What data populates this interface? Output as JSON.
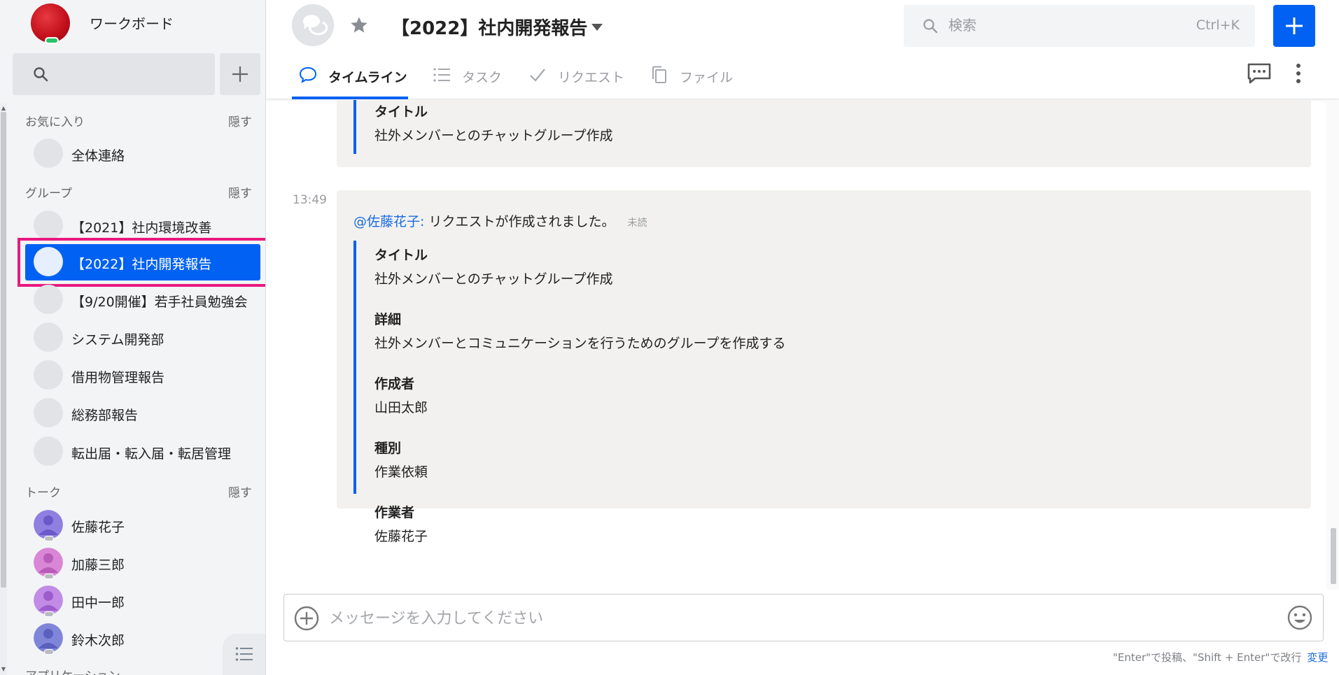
{
  "workspace": {
    "name": "ワークボード"
  },
  "sidebar": {
    "sections": {
      "favorites": {
        "title": "お気に入り",
        "hide_label": "隠す",
        "items": [
          {
            "label": "全体連絡"
          }
        ]
      },
      "groups": {
        "title": "グループ",
        "hide_label": "隠す",
        "items": [
          {
            "label": "【2021】社内環境改善"
          },
          {
            "label": "【2022】社内開発報告",
            "active": true
          },
          {
            "label": "【9/20開催】若手社員勉強会"
          },
          {
            "label": "システム開発部"
          },
          {
            "label": "借用物管理報告"
          },
          {
            "label": "総務部報告"
          },
          {
            "label": "転出届・転入届・転居管理"
          }
        ]
      },
      "talks": {
        "title": "トーク",
        "hide_label": "隠す",
        "items": [
          {
            "label": "佐藤花子",
            "avatar_color": "#8f7fe0"
          },
          {
            "label": "加藤三郎",
            "avatar_color": "#d986d6"
          },
          {
            "label": "田中一郎",
            "avatar_color": "#c28be6"
          },
          {
            "label": "鈴木次郎",
            "avatar_color": "#7f86d9"
          }
        ]
      },
      "apps": {
        "title": "アプリケーション"
      }
    }
  },
  "header": {
    "room_title": "【2022】社内開発報告",
    "search": {
      "placeholder": "検索",
      "shortcut": "Ctrl+K"
    },
    "tabs": [
      {
        "label": "タイムライン",
        "icon": "speech-bubble-icon",
        "active": true
      },
      {
        "label": "タスク",
        "icon": "list-icon"
      },
      {
        "label": "リクエスト",
        "icon": "check-icon"
      },
      {
        "label": "ファイル",
        "icon": "file-copy-icon"
      }
    ]
  },
  "timeline": {
    "previous_card": {
      "fields": [
        {
          "label": "タイトル",
          "value": "社外メンバーとのチャットグループ作成"
        }
      ]
    },
    "message": {
      "time": "13:49",
      "mention": "@佐藤花子:",
      "text": "リクエストが作成されました。",
      "unread": "未読",
      "fields": [
        {
          "label": "タイトル",
          "value": "社外メンバーとのチャットグループ作成"
        },
        {
          "label": "詳細",
          "value": "社外メンバーとコミュニケーションを行うためのグループを作成する"
        },
        {
          "label": "作成者",
          "value": "山田太郎"
        },
        {
          "label": "種別",
          "value": "作業依頼"
        },
        {
          "label": "作業者",
          "value": "佐藤花子"
        }
      ]
    }
  },
  "composer": {
    "placeholder": "メッセージを入力してください",
    "hint": "\"Enter\"で投稿、\"Shift + Enter\"で改行",
    "change_label": "変更"
  },
  "colors": {
    "accent": "#0061f2",
    "highlight": "#e8197f",
    "sidebar_bg": "#f3f4f6",
    "card_bg": "#f2f1ef"
  }
}
